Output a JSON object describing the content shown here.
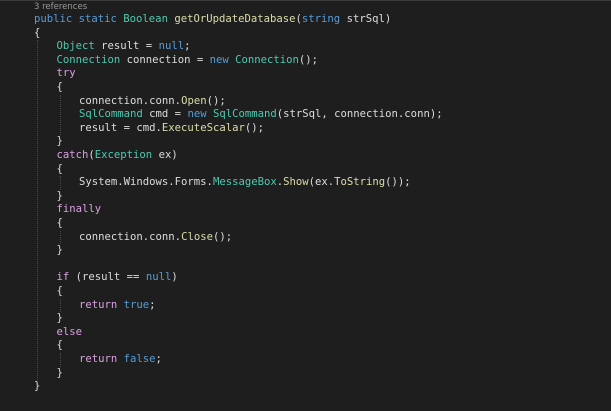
{
  "editor": {
    "codelens": "3 references",
    "lines": [
      {
        "row": 0,
        "indent": 0,
        "tokens": [
          {
            "c": "kw",
            "t": "public static "
          },
          {
            "c": "ty",
            "t": "Boolean "
          },
          {
            "c": "fn",
            "t": "getOrUpdateDatabase"
          },
          {
            "c": "pl",
            "t": "("
          },
          {
            "c": "kw",
            "t": "string "
          },
          {
            "c": "pl",
            "t": "strSql)"
          }
        ]
      },
      {
        "row": 1,
        "indent": 0,
        "tokens": [
          {
            "c": "pl",
            "t": "{"
          }
        ]
      },
      {
        "row": 2,
        "indent": 1,
        "tokens": [
          {
            "c": "ty",
            "t": "Object "
          },
          {
            "c": "pl",
            "t": "result = "
          },
          {
            "c": "kw",
            "t": "null"
          },
          {
            "c": "pl",
            "t": ";"
          }
        ]
      },
      {
        "row": 3,
        "indent": 1,
        "tokens": [
          {
            "c": "ty",
            "t": "Connection "
          },
          {
            "c": "pl",
            "t": "connection = "
          },
          {
            "c": "kw",
            "t": "new "
          },
          {
            "c": "ty",
            "t": "Connection"
          },
          {
            "c": "pl",
            "t": "();"
          }
        ]
      },
      {
        "row": 4,
        "indent": 1,
        "tokens": [
          {
            "c": "ctl",
            "t": "try"
          }
        ]
      },
      {
        "row": 5,
        "indent": 1,
        "tokens": [
          {
            "c": "pl",
            "t": "{"
          }
        ]
      },
      {
        "row": 6,
        "indent": 2,
        "tokens": [
          {
            "c": "pl",
            "t": "connection.conn."
          },
          {
            "c": "fn",
            "t": "Open"
          },
          {
            "c": "pl",
            "t": "();"
          }
        ]
      },
      {
        "row": 7,
        "indent": 2,
        "tokens": [
          {
            "c": "ty",
            "t": "SqlCommand "
          },
          {
            "c": "pl",
            "t": "cmd = "
          },
          {
            "c": "kw",
            "t": "new "
          },
          {
            "c": "ty",
            "t": "SqlCommand"
          },
          {
            "c": "pl",
            "t": "(strSql, connection.conn);"
          }
        ]
      },
      {
        "row": 8,
        "indent": 2,
        "tokens": [
          {
            "c": "pl",
            "t": "result = cmd."
          },
          {
            "c": "fn",
            "t": "ExecuteScalar"
          },
          {
            "c": "pl",
            "t": "();"
          }
        ]
      },
      {
        "row": 9,
        "indent": 1,
        "tokens": [
          {
            "c": "pl",
            "t": "}"
          }
        ]
      },
      {
        "row": 10,
        "indent": 1,
        "tokens": [
          {
            "c": "ctl",
            "t": "catch"
          },
          {
            "c": "pl",
            "t": "("
          },
          {
            "c": "ty",
            "t": "Exception "
          },
          {
            "c": "pl",
            "t": "ex)"
          }
        ]
      },
      {
        "row": 11,
        "indent": 1,
        "tokens": [
          {
            "c": "pl",
            "t": "{"
          }
        ]
      },
      {
        "row": 12,
        "indent": 2,
        "tokens": [
          {
            "c": "pl",
            "t": "System.Windows.Forms."
          },
          {
            "c": "ty",
            "t": "MessageBox"
          },
          {
            "c": "pl",
            "t": "."
          },
          {
            "c": "fn",
            "t": "Show"
          },
          {
            "c": "pl",
            "t": "(ex."
          },
          {
            "c": "fn",
            "t": "ToString"
          },
          {
            "c": "pl",
            "t": "());"
          }
        ]
      },
      {
        "row": 13,
        "indent": 1,
        "tokens": [
          {
            "c": "pl",
            "t": "}"
          }
        ]
      },
      {
        "row": 14,
        "indent": 1,
        "tokens": [
          {
            "c": "ctl",
            "t": "finally"
          }
        ]
      },
      {
        "row": 15,
        "indent": 1,
        "tokens": [
          {
            "c": "pl",
            "t": "{"
          }
        ]
      },
      {
        "row": 16,
        "indent": 2,
        "tokens": [
          {
            "c": "pl",
            "t": "connection.conn."
          },
          {
            "c": "fn",
            "t": "Close"
          },
          {
            "c": "pl",
            "t": "();"
          }
        ]
      },
      {
        "row": 17,
        "indent": 1,
        "tokens": [
          {
            "c": "pl",
            "t": "}"
          }
        ]
      },
      {
        "row": 19,
        "indent": 1,
        "tokens": [
          {
            "c": "ctl",
            "t": "if "
          },
          {
            "c": "pl",
            "t": "(result == "
          },
          {
            "c": "kw",
            "t": "null"
          },
          {
            "c": "pl",
            "t": ")"
          }
        ]
      },
      {
        "row": 20,
        "indent": 1,
        "tokens": [
          {
            "c": "pl",
            "t": "{"
          }
        ]
      },
      {
        "row": 21,
        "indent": 2,
        "tokens": [
          {
            "c": "ctl",
            "t": "return "
          },
          {
            "c": "kw",
            "t": "true"
          },
          {
            "c": "pl",
            "t": ";"
          }
        ]
      },
      {
        "row": 22,
        "indent": 1,
        "tokens": [
          {
            "c": "pl",
            "t": "}"
          }
        ]
      },
      {
        "row": 23,
        "indent": 1,
        "tokens": [
          {
            "c": "ctl",
            "t": "else"
          }
        ]
      },
      {
        "row": 24,
        "indent": 1,
        "tokens": [
          {
            "c": "pl",
            "t": "{"
          }
        ]
      },
      {
        "row": 25,
        "indent": 2,
        "tokens": [
          {
            "c": "ctl",
            "t": "return "
          },
          {
            "c": "kw",
            "t": "false"
          },
          {
            "c": "pl",
            "t": ";"
          }
        ]
      },
      {
        "row": 26,
        "indent": 1,
        "tokens": [
          {
            "c": "pl",
            "t": "}"
          }
        ]
      },
      {
        "row": 27,
        "indent": 0,
        "tokens": [
          {
            "c": "pl",
            "t": "}"
          }
        ]
      }
    ]
  },
  "theme": {
    "background": "#1e1e1e",
    "keyword": "#569cd6",
    "type": "#4ec9b0",
    "method": "#dcdcaa",
    "control": "#d8a0df",
    "plain": "#dcdcdc"
  }
}
